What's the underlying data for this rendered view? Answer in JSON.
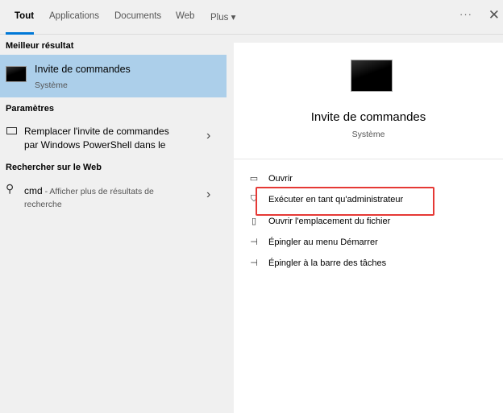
{
  "tabs": [
    "Tout",
    "Applications",
    "Documents",
    "Web",
    "Plus ▾"
  ],
  "more_icon": "···",
  "close_icon": "✕",
  "best_match": {
    "heading": "Meilleur résultat",
    "title": "Invite de commandes",
    "subtitle": "Système"
  },
  "settings": {
    "heading": "Paramètres",
    "line1": "Remplacer l'invite de commandes",
    "line2": "par Windows PowerShell dans le"
  },
  "web": {
    "heading": "Rechercher sur le Web",
    "query": "cmd",
    "suffix": " - Afficher plus de résultats de",
    "line2": "recherche"
  },
  "detail": {
    "title": "Invite de commandes",
    "subtitle": "Système"
  },
  "actions": [
    {
      "label": "Ouvrir",
      "icon": "open-icon"
    },
    {
      "label": "Exécuter en tant qu'administrateur",
      "icon": "shield-icon"
    },
    {
      "label": "Ouvrir l'emplacement du fichier",
      "icon": "folder-icon"
    },
    {
      "label": "Épingler au menu Démarrer",
      "icon": "pin-icon"
    },
    {
      "label": "Épingler à la barre des tâches",
      "icon": "pin-icon"
    }
  ],
  "highlight_color": "#e53935"
}
